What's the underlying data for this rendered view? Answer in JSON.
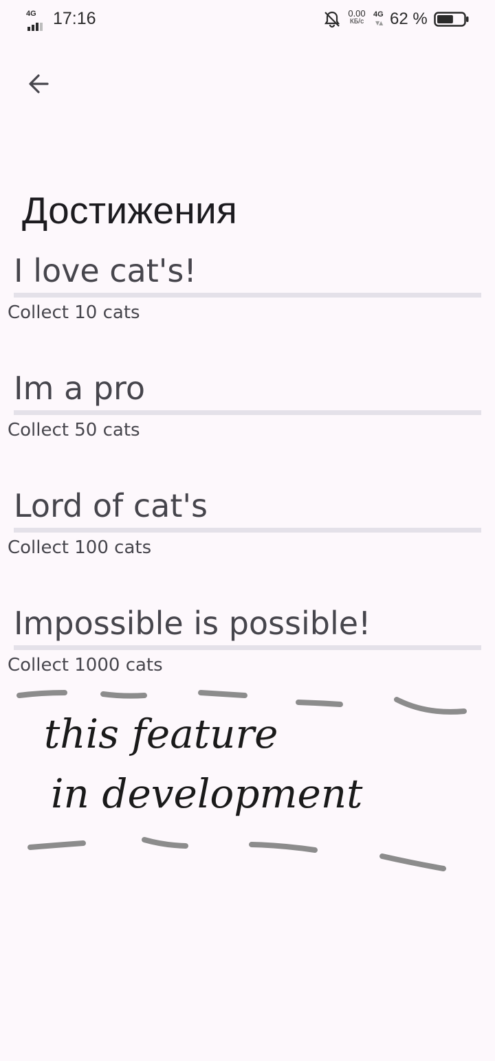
{
  "status_bar": {
    "network_left": "4G",
    "time": "17:16",
    "speed_value": "0.00",
    "speed_unit": "КБ/с",
    "network_right": "4G",
    "battery_percent": "62 %",
    "battery_level": 0.62,
    "icons": [
      "signal-icon",
      "bell-off-icon",
      "battery-icon"
    ]
  },
  "header": {
    "back_icon": "arrow-left-icon"
  },
  "page": {
    "title": "Достижения"
  },
  "achievements": [
    {
      "title": "I love cat's!",
      "description": "Collect 10 cats",
      "progress": 0
    },
    {
      "title": "Im a pro",
      "description": "Collect 50 cats",
      "progress": 0
    },
    {
      "title": "Lord of cat's",
      "description": "Collect 100 cats",
      "progress": 0
    },
    {
      "title": "Impossible is possible!",
      "description": "Collect 1000 cats",
      "progress": 0
    }
  ],
  "dev_note": {
    "line1": "this feature",
    "line2": "in development"
  }
}
